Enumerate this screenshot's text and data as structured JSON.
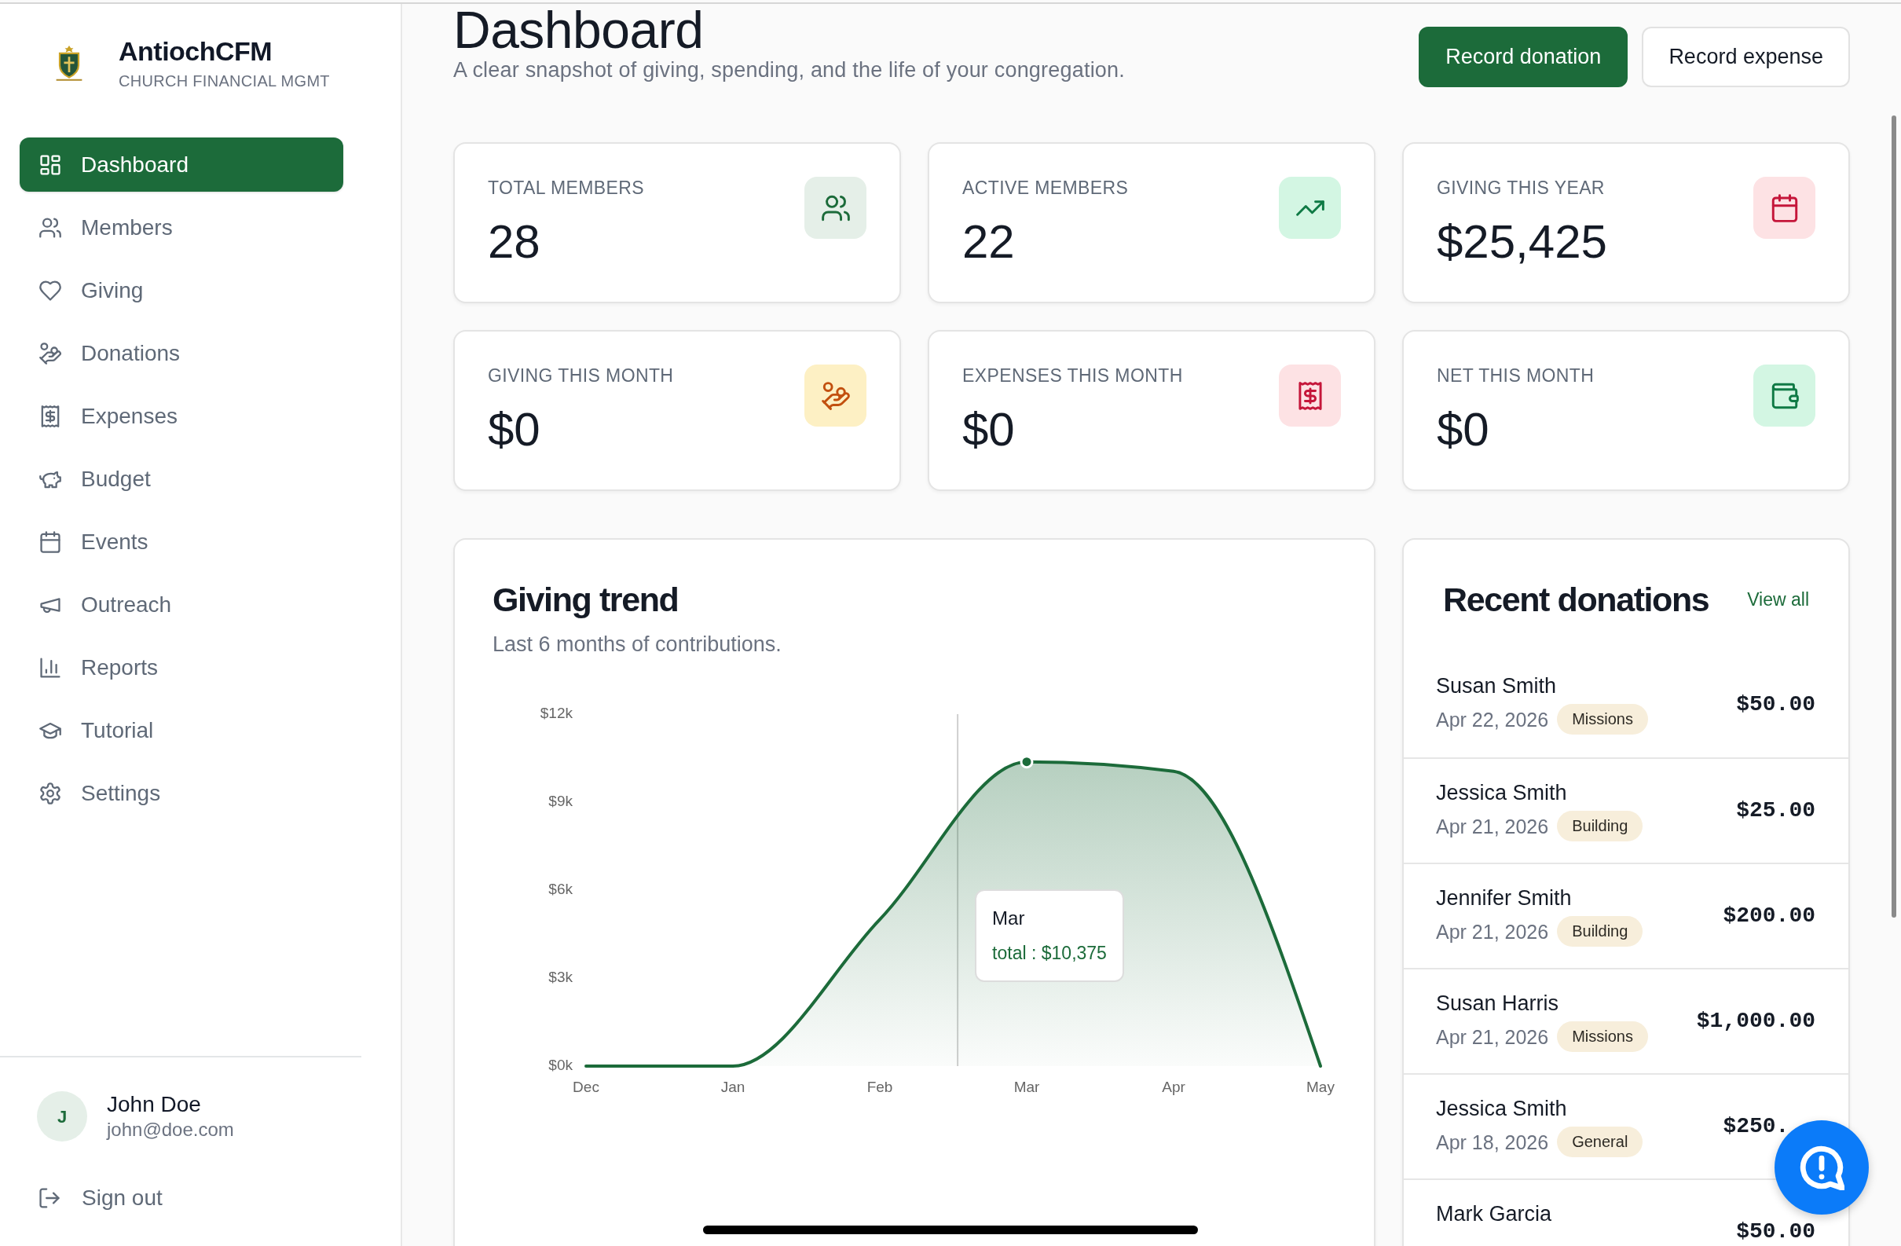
{
  "sidebar": {
    "brand": {
      "name": "AntiochCFM",
      "tagline": "CHURCH FINANCIAL MGMT"
    },
    "items": [
      {
        "label": "Dashboard",
        "selected": true
      },
      {
        "label": "Members",
        "selected": false
      },
      {
        "label": "Giving",
        "selected": false
      },
      {
        "label": "Donations",
        "selected": false
      },
      {
        "label": "Expenses",
        "selected": false
      },
      {
        "label": "Budget",
        "selected": false
      },
      {
        "label": "Events",
        "selected": false
      },
      {
        "label": "Outreach",
        "selected": false
      },
      {
        "label": "Reports",
        "selected": false
      },
      {
        "label": "Tutorial",
        "selected": false
      },
      {
        "label": "Settings",
        "selected": false
      }
    ],
    "user": {
      "initial": "J",
      "name": "John Doe",
      "email": "john@doe.com"
    },
    "sign_out": "Sign out"
  },
  "header": {
    "title": "Dashboard",
    "subtitle": "A clear snapshot of giving, spending, and the life of your congregation.",
    "buttons": [
      {
        "label": "Record donation",
        "kind": "primary"
      },
      {
        "label": "Record expense",
        "kind": "secondary"
      }
    ]
  },
  "stats": [
    {
      "label": "TOTAL MEMBERS",
      "value": "28"
    },
    {
      "label": "ACTIVE MEMBERS",
      "value": "22"
    },
    {
      "label": "GIVING THIS YEAR",
      "value": "$25,425"
    },
    {
      "label": "GIVING THIS MONTH",
      "value": "$0"
    },
    {
      "label": "EXPENSES THIS MONTH",
      "value": "$0"
    },
    {
      "label": "NET THIS MONTH",
      "value": "$0"
    }
  ],
  "giving_trend": {
    "title": "Giving trend",
    "subtitle": "Last 6 months of contributions.",
    "chart_data": {
      "type": "area",
      "categories": [
        "Dec",
        "Jan",
        "Feb",
        "Mar",
        "Apr",
        "May"
      ],
      "series": [
        {
          "color": "#1c6b3a",
          "values": [
            0,
            0,
            5000,
            10375,
            10050,
            0
          ]
        }
      ],
      "ylim": [
        0,
        12000
      ],
      "yticks": [
        {
          "value": 0,
          "label": "$0k"
        },
        {
          "value": 3000,
          "label": "$3k"
        },
        {
          "value": 6000,
          "label": "$6k"
        },
        {
          "value": 9000,
          "label": "$9k"
        },
        {
          "value": 12000,
          "label": "$12k"
        }
      ],
      "annotations": [
        {
          "x": "Mar"
        }
      ]
    },
    "tooltip": {
      "title": "Mar",
      "text": "total : $10,375"
    }
  },
  "recent_donations": {
    "title": "Recent donations",
    "link": "View all",
    "items": [
      {
        "name": "Susan Smith",
        "date": "Apr 22, 2026",
        "fund": "Missions",
        "amount": "$50.00"
      },
      {
        "name": "Jessica Smith",
        "date": "Apr 21, 2026",
        "fund": "Building",
        "amount": "$25.00"
      },
      {
        "name": "Jennifer Smith",
        "date": "Apr 21, 2026",
        "fund": "Building",
        "amount": "$200.00"
      },
      {
        "name": "Susan Harris",
        "date": "Apr 21, 2026",
        "fund": "Missions",
        "amount": "$1,000.00"
      },
      {
        "name": "Jessica Smith",
        "date": "Apr 18, 2026",
        "fund": "General",
        "amount": "$250."
      },
      {
        "name": "Mark Garcia",
        "amount": "$50.00"
      }
    ]
  }
}
